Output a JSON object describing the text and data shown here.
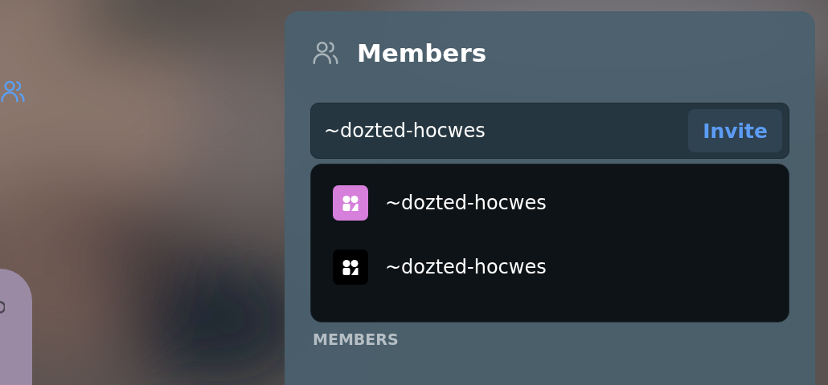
{
  "panel": {
    "title": "Members"
  },
  "invite": {
    "value": "~dozted-hocwes",
    "button": "Invite"
  },
  "suggestions": [
    {
      "name": "~dozted-hocwes",
      "color": "#d67fdb"
    },
    {
      "name": "~dozted-hocwes",
      "color": "#000000"
    }
  ],
  "section_heading": "MEMBERS"
}
